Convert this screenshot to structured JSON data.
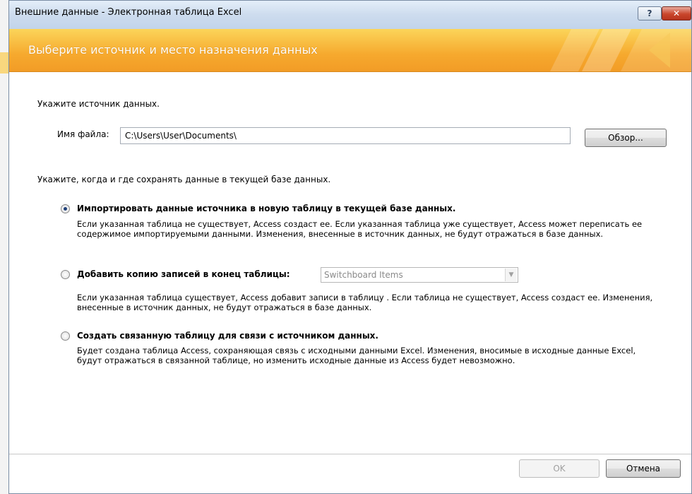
{
  "window": {
    "title": "Внешние данные - Электронная таблица Excel",
    "help_label": "?",
    "close_label": "✕"
  },
  "banner": {
    "heading": "Выберите источник и место назначения данных"
  },
  "source": {
    "label": "Укажите источник данных.",
    "file_label": "Имя файла:",
    "file_value": "C:\\Users\\User\\Documents\\",
    "browse_label": "Обзор..."
  },
  "destination": {
    "label": "Укажите, когда и где сохранять данные в текущей базе данных.",
    "options": [
      {
        "title": "Импортировать данные источника в новую таблицу в текущей базе данных.",
        "description": "Если указанная таблица не существует, Access создаст ее. Если указанная таблица уже существует, Access может переписать ее содержимое импортируемыми данными. Изменения, внесенные в источник данных, не будут отражаться в базе данных.",
        "selected": true
      },
      {
        "title": "Добавить копию записей в конец таблицы:",
        "description": "Если указанная таблица существует, Access добавит записи в таблицу . Если таблица не существует, Access создаст ее. Изменения, внесенные в источник данных, не будут отражаться в базе данных.",
        "selected": false,
        "combo_value": "Switchboard Items"
      },
      {
        "title": "Создать связанную таблицу для связи с источником данных.",
        "description": "Будет создана таблица Access, сохраняющая связь с исходными данными Excel. Изменения, вносимые в исходные данные Excel, будут отражаться в связанной таблице, но изменить исходные данные из Access будет невозможно.",
        "selected": false
      }
    ]
  },
  "footer": {
    "ok_label": "OK",
    "cancel_label": "Отмена"
  },
  "colors": {
    "banner_start": "#fbd55a",
    "banner_end": "#f29c26",
    "close_button": "#c9462c"
  }
}
